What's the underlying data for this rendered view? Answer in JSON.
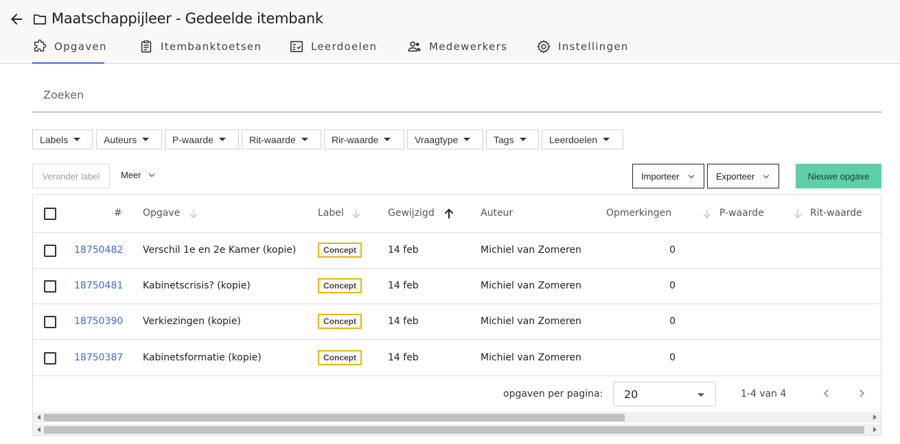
{
  "header": {
    "title": "Maatschappijleer - Gedeelde itembank",
    "tabs": [
      {
        "label": "Opgaven",
        "icon": "puzzle-icon",
        "active": true
      },
      {
        "label": "Itembanktoetsen",
        "icon": "clipboard-icon",
        "active": false
      },
      {
        "label": "Leerdoelen",
        "icon": "checklist-icon",
        "active": false
      },
      {
        "label": "Medewerkers",
        "icon": "people-icon",
        "active": false
      },
      {
        "label": "Instellingen",
        "icon": "gear-icon",
        "active": false
      }
    ]
  },
  "search": {
    "placeholder": "Zoeken",
    "value": ""
  },
  "filters": [
    "Labels",
    "Auteurs",
    "P-waarde",
    "Rit-waarde",
    "Rir-waarde",
    "Vraagtype",
    "Tags",
    "Leerdoelen"
  ],
  "toolbar": {
    "change_label": "Verander label",
    "more": "Meer",
    "import": "Importeer",
    "export": "Exporteer",
    "new": "Nieuwe opgave"
  },
  "table": {
    "columns": {
      "id": "#",
      "opgave": "Opgave",
      "label": "Label",
      "gewijzigd": "Gewijzigd",
      "auteur": "Auteur",
      "opmerkingen": "Opmerkingen",
      "p_waarde": "P-waarde",
      "rit_waarde": "Rit-waarde"
    },
    "rows": [
      {
        "id": "18750482",
        "opgave": "Verschil 1e en 2e Kamer (kopie)",
        "label": "Concept",
        "gewijzigd": "14 feb",
        "auteur": "Michiel van Zomeren",
        "opmerkingen": "0"
      },
      {
        "id": "18750481",
        "opgave": "Kabinetscrisis? (kopie)",
        "label": "Concept",
        "gewijzigd": "14 feb",
        "auteur": "Michiel van Zomeren",
        "opmerkingen": "0"
      },
      {
        "id": "18750390",
        "opgave": "Verkiezingen (kopie)",
        "label": "Concept",
        "gewijzigd": "14 feb",
        "auteur": "Michiel van Zomeren",
        "opmerkingen": "0"
      },
      {
        "id": "18750387",
        "opgave": "Kabinetsformatie (kopie)",
        "label": "Concept",
        "gewijzigd": "14 feb",
        "auteur": "Michiel van Zomeren",
        "opmerkingen": "0"
      }
    ]
  },
  "pagination": {
    "per_page_label": "opgaven per pagina:",
    "per_page": "20",
    "range": "1-4 van 4"
  },
  "colors": {
    "accent": "#3b6ad8",
    "primary_button": "#5ecfa9",
    "badge_border": "#e8b600"
  }
}
